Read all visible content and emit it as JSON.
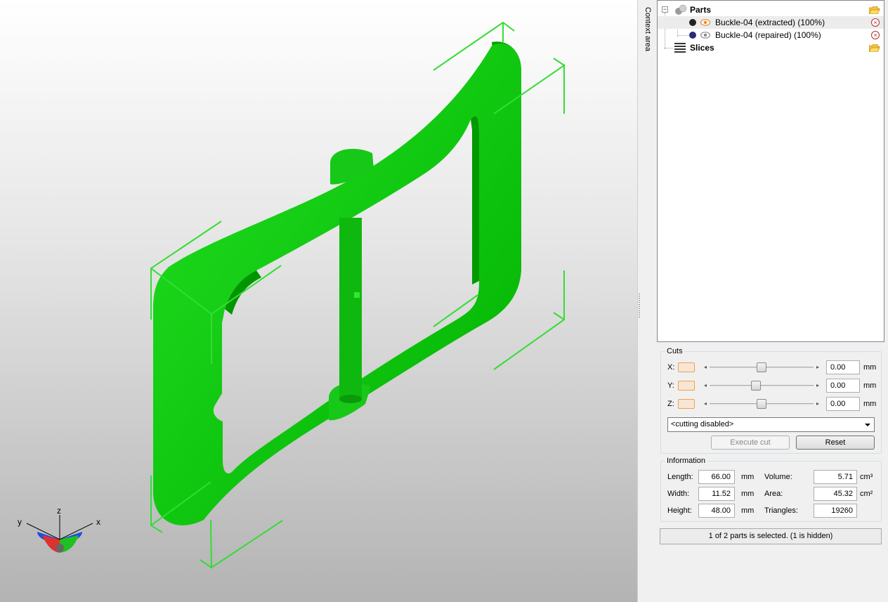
{
  "viewport": {
    "model_color": "#00cc00",
    "bbox_color": "#33dd33",
    "background_top": "#ffffff",
    "background_bottom": "#b3b3b3",
    "axis_labels": {
      "x": "x",
      "y": "y",
      "z": "z"
    }
  },
  "sidebar": {
    "context_label": "Context area"
  },
  "tree": {
    "parts_label": "Parts",
    "items": [
      {
        "label": "Buckle-04 (extracted) (100%)",
        "dot_color": "#222222",
        "selected": true,
        "eye_color": "#e8892a"
      },
      {
        "label": "Buckle-04 (repaired) (100%)",
        "dot_color": "#2a2a7a",
        "selected": false,
        "eye_color": "#8a8a8a"
      }
    ],
    "slices_label": "Slices"
  },
  "cuts": {
    "title": "Cuts",
    "rows": [
      {
        "axis": "X:",
        "value": "0.00",
        "unit": "mm",
        "slider_position": 0.5
      },
      {
        "axis": "Y:",
        "value": "0.00",
        "unit": "mm",
        "slider_position": 0.45
      },
      {
        "axis": "Z:",
        "value": "0.00",
        "unit": "mm",
        "slider_position": 0.5
      }
    ],
    "mode": "<cutting disabled>",
    "execute_label": "Execute cut",
    "reset_label": "Reset"
  },
  "information": {
    "title": "Information",
    "length_label": "Length:",
    "length_value": "66.00",
    "length_unit": "mm",
    "width_label": "Width:",
    "width_value": "11.52",
    "width_unit": "mm",
    "height_label": "Height:",
    "height_value": "48.00",
    "height_unit": "mm",
    "volume_label": "Volume:",
    "volume_value": "5.71",
    "volume_unit": "cm³",
    "area_label": "Area:",
    "area_value": "45.32",
    "area_unit": "cm²",
    "triangles_label": "Triangles:",
    "triangles_value": "19260"
  },
  "status": {
    "text": "1 of 2 parts is selected. (1 is hidden)"
  }
}
